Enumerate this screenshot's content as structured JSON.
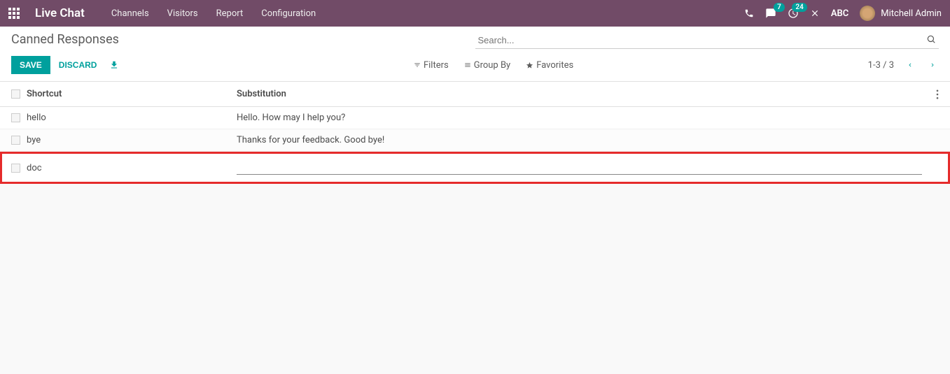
{
  "navbar": {
    "app_title": "Live Chat",
    "menu": [
      "Channels",
      "Visitors",
      "Report",
      "Configuration"
    ],
    "msg_badge": "7",
    "activity_badge": "24",
    "company": "ABC",
    "user": "Mitchell Admin"
  },
  "header": {
    "page_title": "Canned Responses",
    "search_placeholder": "Search...",
    "save": "SAVE",
    "discard": "DISCARD",
    "filters": "Filters",
    "group_by": "Group By",
    "favorites": "Favorites",
    "pager": "1-3 / 3"
  },
  "table": {
    "col_shortcut": "Shortcut",
    "col_substitution": "Substitution",
    "rows": [
      {
        "shortcut": "hello",
        "substitution": "Hello. How may I help you?"
      },
      {
        "shortcut": "bye",
        "substitution": "Thanks for your feedback. Good bye!"
      },
      {
        "shortcut": "doc",
        "substitution": ""
      }
    ]
  }
}
